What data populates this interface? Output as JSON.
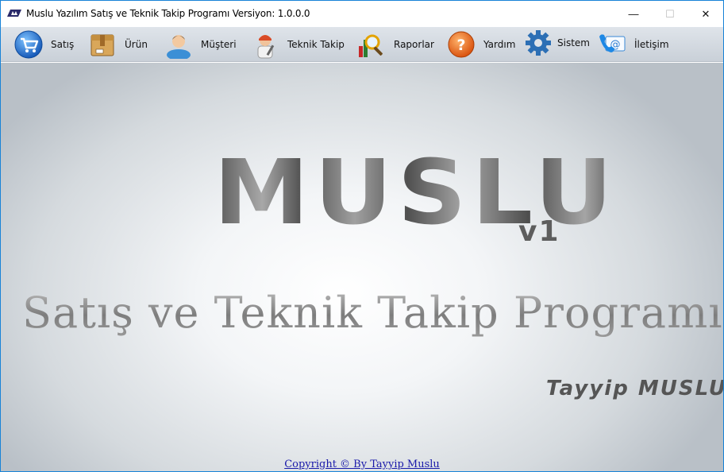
{
  "window": {
    "title": "Muslu Yazılım Satış ve Teknik Takip Programı  Versiyon: 1.0.0.0",
    "minimize_glyph": "—",
    "maximize_glyph": "☐",
    "close_glyph": "✕"
  },
  "toolbar": {
    "items": [
      {
        "label": "Satış",
        "icon": "shopping-cart-icon"
      },
      {
        "label": "Ürün",
        "icon": "box-icon"
      },
      {
        "label": "Müşteri",
        "icon": "user-icon"
      },
      {
        "label": "Teknik Takip",
        "icon": "technician-icon"
      },
      {
        "label": "Raporlar",
        "icon": "report-magnifier-icon"
      },
      {
        "label": "Yardım",
        "icon": "help-icon"
      },
      {
        "label": "Sistem",
        "icon": "gear-icon"
      },
      {
        "label": "İletişim",
        "icon": "contact-mail-icon"
      }
    ]
  },
  "main": {
    "logo_text": "MUSLU",
    "version_text": "v1",
    "subtitle": "Satış ve Teknik Takip Programı",
    "author": "Tayyip MUSLU",
    "copyright": "Copyright © By Tayyip Muslu"
  },
  "colors": {
    "window_border": "#1883d7",
    "toolbar_bg": "#d3d9e0",
    "link": "#1a1aaa"
  }
}
